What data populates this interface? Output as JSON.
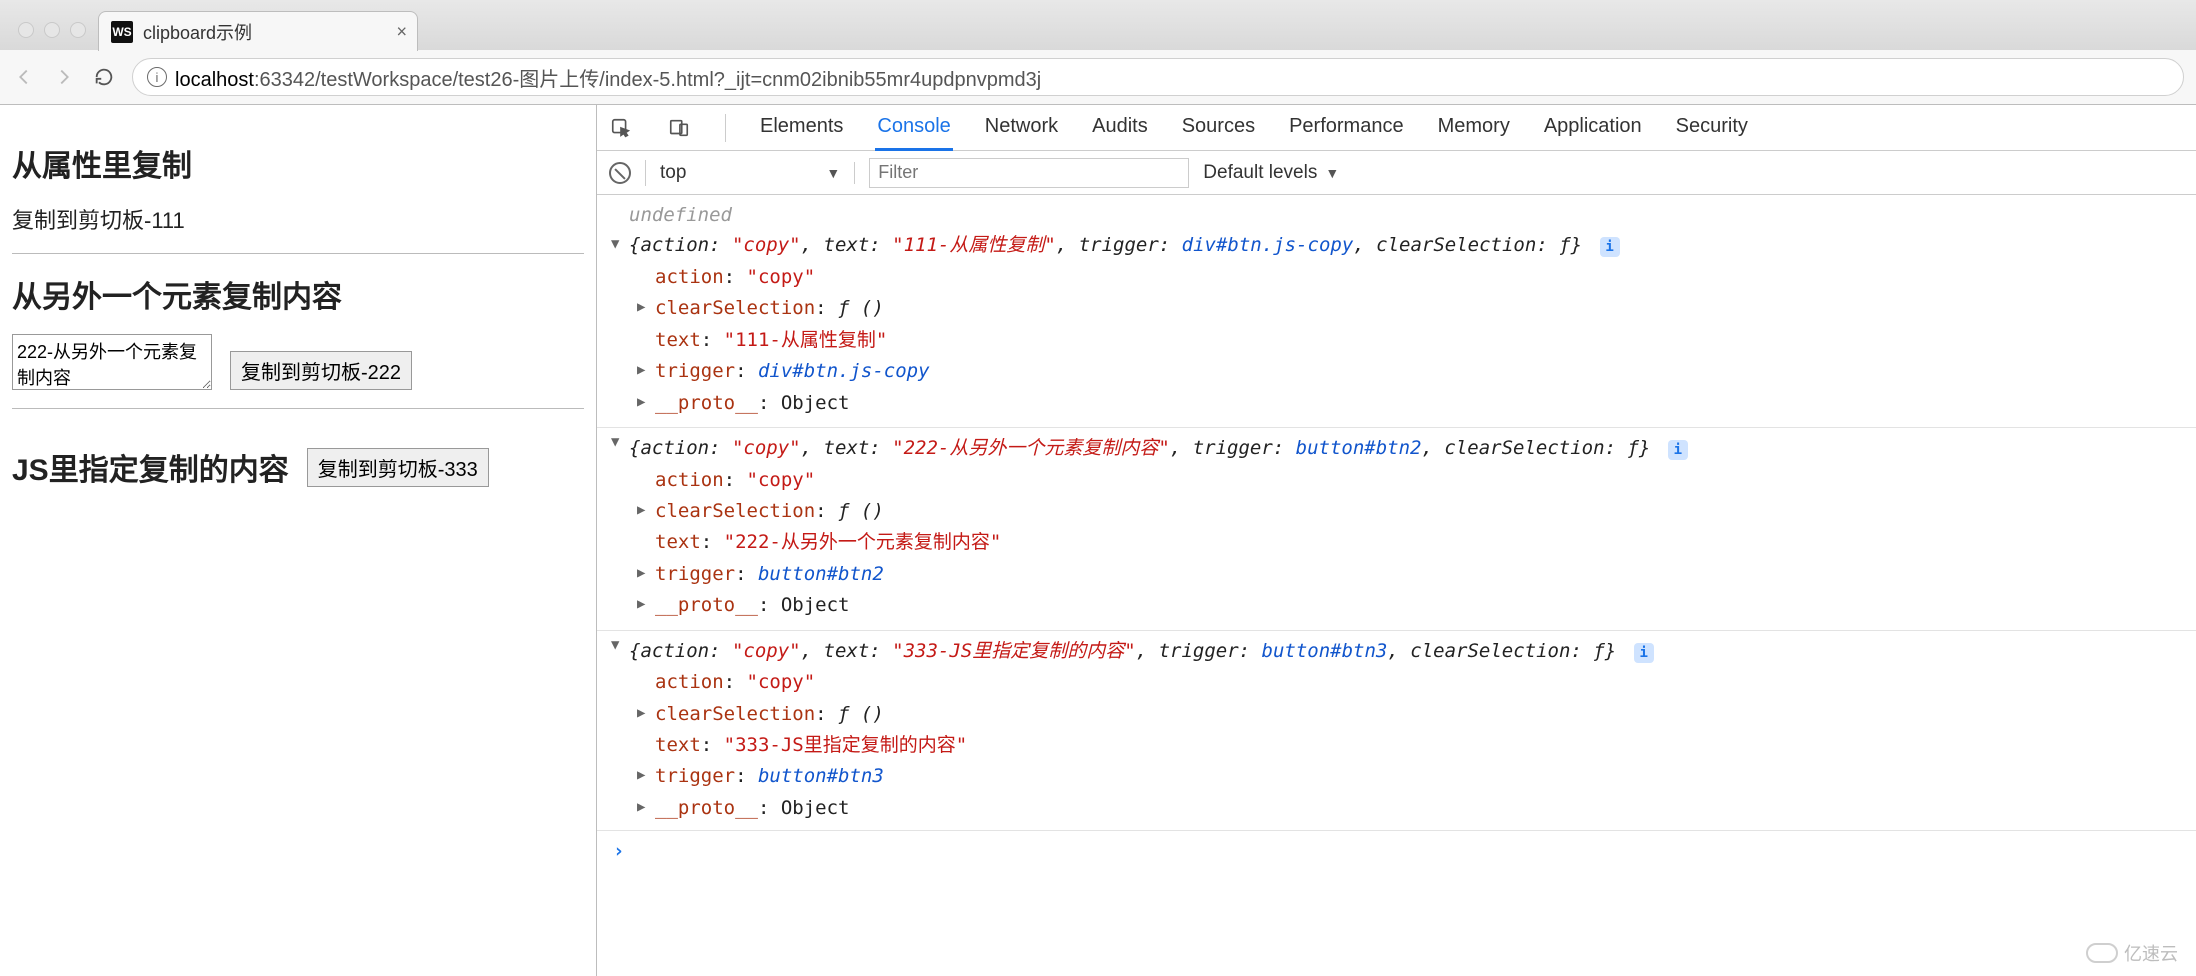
{
  "browser": {
    "tab_title": "clipboard示例",
    "favicon_text": "WS",
    "back_enabled": false,
    "forward_enabled": false,
    "url_host": "localhost",
    "url_port": ":63342",
    "url_path": "/testWorkspace/test26-图片上传/index-5.html?_ijt=cnm02ibnib55mr4updpnvpmd3j"
  },
  "page": {
    "section1_title": "从属性里复制",
    "section1_text": "复制到剪切板-111",
    "section2_title": "从另外一个元素复制内容",
    "textarea_value": "222-从另外一个元素复制内容",
    "btn2_label": "复制到剪切板-222",
    "section3_title": "JS里指定复制的内容",
    "btn3_label": "复制到剪切板-333"
  },
  "devtools": {
    "tabs": {
      "elements": "Elements",
      "console": "Console",
      "network": "Network",
      "audits": "Audits",
      "sources": "Sources",
      "performance": "Performance",
      "memory": "Memory",
      "application": "Application",
      "security": "Security"
    },
    "toolbar": {
      "context": "top",
      "filter_placeholder": "Filter",
      "levels": "Default levels"
    },
    "console": {
      "undefined_label": "undefined",
      "action_key": "action",
      "copy_val": "\"copy\"",
      "text_key": "text",
      "trigger_key": "trigger",
      "clearsel_key": "clearSelection",
      "clearsel_val": "ƒ ()",
      "clearsel_inline": "ƒ",
      "proto_key": "__proto__",
      "object_val": "Object",
      "info_badge": "i",
      "entries": [
        {
          "text_val": "\"111-从属性复制\"",
          "trigger_val": "div#btn.js-copy"
        },
        {
          "text_val": "\"222-从另外一个元素复制内容\"",
          "trigger_val": "button#btn2"
        },
        {
          "text_val": "\"333-JS里指定复制的内容\"",
          "trigger_val": "button#btn3"
        }
      ],
      "prompt": "›"
    }
  },
  "watermark": "亿速云"
}
